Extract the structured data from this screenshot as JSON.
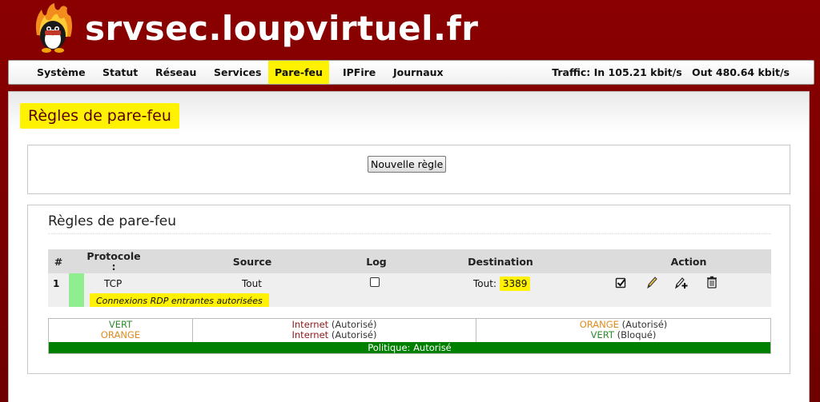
{
  "header": {
    "site_title": "srvsec.loupvirtuel.fr"
  },
  "nav": {
    "items": [
      {
        "label": "Système",
        "active": false
      },
      {
        "label": "Statut",
        "active": false
      },
      {
        "label": "Réseau",
        "active": false
      },
      {
        "label": "Services",
        "active": false
      },
      {
        "label": "Pare-feu",
        "active": true
      },
      {
        "label": "IPFire",
        "active": false
      },
      {
        "label": "Journaux",
        "active": false
      }
    ],
    "traffic_in": "Traffic: In 105.21 kbit/s",
    "traffic_out": "Out 480.64 kbit/s"
  },
  "page": {
    "title": "Règles de pare-feu"
  },
  "new_rule": {
    "button_label": "Nouvelle règle"
  },
  "rules": {
    "title": "Règles de pare-feu",
    "columns": {
      "num": "#",
      "protocol_line1": "Protocole",
      "protocol_line2": ":",
      "source": "Source",
      "log": "Log",
      "destination": "Destination",
      "action": "Action"
    },
    "row": {
      "num": "1",
      "protocol": "TCP",
      "source": "Tout",
      "log_checked": false,
      "destination_label": "Tout:",
      "destination_port": "3389",
      "enabled": true,
      "remark": "Connexions RDP entrantes autorisées",
      "actions": [
        "enable-checkbox-icon",
        "edit-pencil-icon",
        "copy-add-icon",
        "trash-icon"
      ]
    },
    "policy": {
      "col1": {
        "line1": "VERT",
        "line2": "ORANGE"
      },
      "col2": {
        "line1_zone": "Internet",
        "line1_status": "(Autorisé)",
        "line2_zone": "Internet",
        "line2_status": "(Autorisé)"
      },
      "col3": {
        "line1_zone": "ORANGE",
        "line1_status": "(Autorisé)",
        "line2_zone": "VERT",
        "line2_status": "(Bloqué)"
      },
      "bar": "Politique: Autorisé"
    }
  },
  "colors": {
    "brand_red": "#8a0000",
    "highlight_yellow": "#fff200",
    "green_zone": "#2e8b2e",
    "orange_zone": "#e08a1e",
    "red_zone": "#8b1a1a",
    "policy_bar": "#008000"
  }
}
